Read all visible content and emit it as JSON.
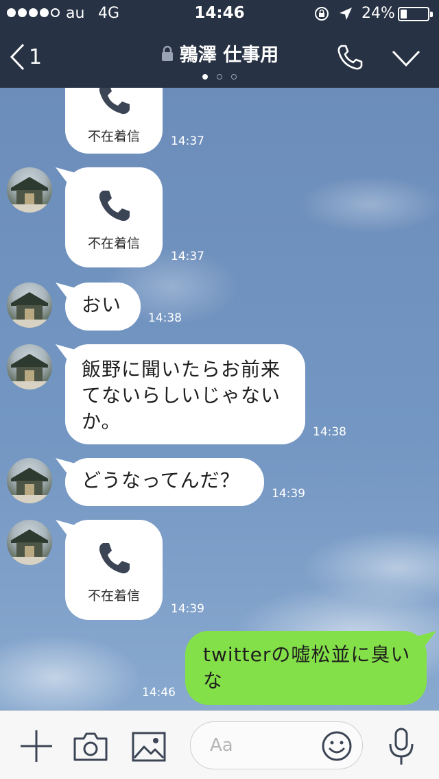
{
  "status_bar": {
    "signal_dots": 5,
    "signal_filled": 4,
    "carrier": "au",
    "network": "4G",
    "time": "14:46",
    "battery_percent": "24%",
    "battery_level": 0.24,
    "icons": [
      "rotation-lock-icon",
      "location-arrow-icon",
      "battery-icon"
    ]
  },
  "header": {
    "back_count": "1",
    "title": "鶉澤 仕事用",
    "page_count": 3,
    "active_page": 1,
    "icons": [
      "back-chevron-icon",
      "lock-icon",
      "phone-icon",
      "chevron-down-icon"
    ]
  },
  "messages": [
    {
      "side": "left",
      "type": "missed_call",
      "label": "不在着信",
      "time": "14:37"
    },
    {
      "side": "left",
      "type": "missed_call",
      "label": "不在着信",
      "time": "14:37"
    },
    {
      "side": "left",
      "type": "text",
      "lines": [
        "おい"
      ],
      "time": "14:38"
    },
    {
      "side": "left",
      "type": "text",
      "lines": [
        "飯野に聞いたらお前来",
        "てないらしいじゃない",
        "か。"
      ],
      "time": "14:38"
    },
    {
      "side": "left",
      "type": "text",
      "lines": [
        "どうなってんだ？"
      ],
      "time": "14:39"
    },
    {
      "side": "left",
      "type": "missed_call",
      "label": "不在着信",
      "time": "14:39"
    },
    {
      "side": "right",
      "type": "text",
      "lines": [
        "twitterの嘘松並に臭い",
        "な"
      ],
      "time": "14:46"
    }
  ],
  "input_bar": {
    "placeholder": "Aa",
    "icons": [
      "plus-icon",
      "camera-icon",
      "image-icon",
      "emoji-icon",
      "microphone-icon"
    ]
  },
  "colors": {
    "bar_bg": "#273244",
    "chat_bg": "#6f8fba",
    "incoming_bubble": "#ffffff",
    "outgoing_bubble": "#84e048"
  }
}
